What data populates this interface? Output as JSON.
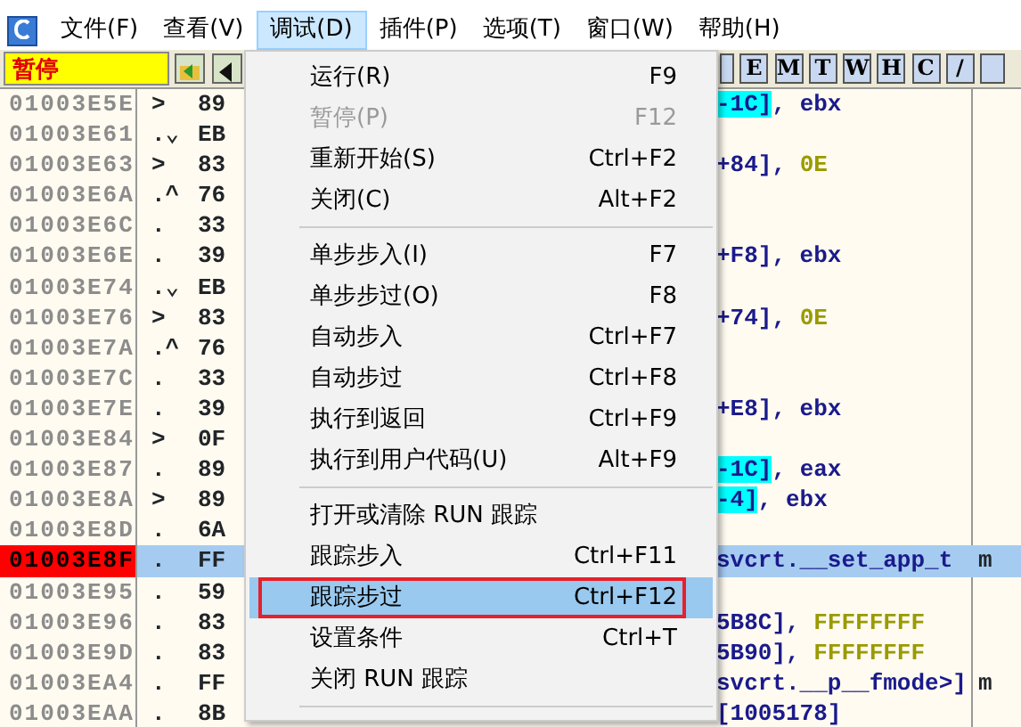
{
  "menubar": {
    "items": [
      {
        "label": "文件(F)",
        "selected": false
      },
      {
        "label": "查看(V)",
        "selected": false
      },
      {
        "label": "调试(D)",
        "selected": true
      },
      {
        "label": "插件(P)",
        "selected": false
      },
      {
        "label": "选项(T)",
        "selected": false
      },
      {
        "label": "窗口(W)",
        "selected": false
      },
      {
        "label": "帮助(H)",
        "selected": false
      }
    ]
  },
  "toolbar": {
    "status": "暂停",
    "letter_buttons": [
      "E",
      "M",
      "T",
      "W",
      "H",
      "C",
      "/"
    ]
  },
  "listing": {
    "rows": [
      {
        "address": "01003E5E",
        "mark": ">",
        "hex": "89",
        "disasm": [
          {
            "text": "-1C]",
            "kind": "operand"
          },
          {
            "text": ", ebx",
            "kind": "plain"
          }
        ],
        "current": false,
        "selected": false
      },
      {
        "address": "01003E61",
        "mark": ".⌄",
        "hex": "EB",
        "disasm": [],
        "current": false,
        "selected": false
      },
      {
        "address": "01003E63",
        "mark": ">",
        "hex": "83",
        "disasm": [
          {
            "text": "+84], ",
            "kind": "plain"
          },
          {
            "text": "0E",
            "kind": "const"
          }
        ],
        "current": false,
        "selected": false
      },
      {
        "address": "01003E6A",
        "mark": ".^",
        "hex": "76",
        "disasm": [],
        "current": false,
        "selected": false
      },
      {
        "address": "01003E6C",
        "mark": ".",
        "hex": "33",
        "disasm": [],
        "current": false,
        "selected": false
      },
      {
        "address": "01003E6E",
        "mark": ".",
        "hex": "39",
        "disasm": [
          {
            "text": "+F8], ebx",
            "kind": "plain"
          }
        ],
        "current": false,
        "selected": false
      },
      {
        "address": "01003E74",
        "mark": ".⌄",
        "hex": "EB",
        "disasm": [],
        "current": false,
        "selected": false
      },
      {
        "address": "01003E76",
        "mark": ">",
        "hex": "83",
        "disasm": [
          {
            "text": "+74], ",
            "kind": "plain"
          },
          {
            "text": "0E",
            "kind": "const"
          }
        ],
        "current": false,
        "selected": false
      },
      {
        "address": "01003E7A",
        "mark": ".^",
        "hex": "76",
        "disasm": [],
        "current": false,
        "selected": false
      },
      {
        "address": "01003E7C",
        "mark": ".",
        "hex": "33",
        "disasm": [],
        "current": false,
        "selected": false
      },
      {
        "address": "01003E7E",
        "mark": ".",
        "hex": "39",
        "disasm": [
          {
            "text": "+E8], ebx",
            "kind": "plain"
          }
        ],
        "current": false,
        "selected": false
      },
      {
        "address": "01003E84",
        "mark": ">",
        "hex": "0F",
        "disasm": [],
        "current": false,
        "selected": false
      },
      {
        "address": "01003E87",
        "mark": ".",
        "hex": "89",
        "disasm": [
          {
            "text": "-1C]",
            "kind": "operand"
          },
          {
            "text": ", eax",
            "kind": "plain"
          }
        ],
        "current": false,
        "selected": false
      },
      {
        "address": "01003E8A",
        "mark": ">",
        "hex": "89",
        "disasm": [
          {
            "text": "-4]",
            "kind": "operand"
          },
          {
            "text": ", ebx",
            "kind": "plain"
          }
        ],
        "current": false,
        "selected": false
      },
      {
        "address": "01003E8D",
        "mark": ".",
        "hex": "6A",
        "disasm": [],
        "current": false,
        "selected": false
      },
      {
        "address": "01003E8F",
        "mark": ".",
        "hex": "FF",
        "disasm": [
          {
            "text": "svcrt.__set_app_t",
            "kind": "plain"
          }
        ],
        "comment": "m",
        "current": true,
        "selected": true
      },
      {
        "address": "01003E95",
        "mark": ".",
        "hex": "59",
        "disasm": [],
        "current": false,
        "selected": false
      },
      {
        "address": "01003E96",
        "mark": ".",
        "hex": "83",
        "disasm": [
          {
            "text": "5B8C], ",
            "kind": "plain"
          },
          {
            "text": "FFFFFFFF",
            "kind": "const"
          }
        ],
        "current": false,
        "selected": false
      },
      {
        "address": "01003E9D",
        "mark": ".",
        "hex": "83",
        "disasm": [
          {
            "text": "5B90], ",
            "kind": "plain"
          },
          {
            "text": "FFFFFFFF",
            "kind": "const"
          }
        ],
        "current": false,
        "selected": false
      },
      {
        "address": "01003EA4",
        "mark": ".",
        "hex": "FF",
        "disasm": [
          {
            "text": "svcrt.__p__fmode>]",
            "kind": "plain"
          }
        ],
        "comment": "m",
        "current": false,
        "selected": false
      },
      {
        "address": "01003EAA",
        "mark": ".",
        "hex": "8B",
        "disasm": [
          {
            "text": " [1005178]",
            "kind": "plain"
          }
        ],
        "current": false,
        "selected": false
      }
    ]
  },
  "dropdown_menu": {
    "items": [
      {
        "kind": "item",
        "label": "运行(R)",
        "shortcut": "F9",
        "disabled": false,
        "selected": false
      },
      {
        "kind": "item",
        "label": "暂停(P)",
        "shortcut": "F12",
        "disabled": true,
        "selected": false
      },
      {
        "kind": "item",
        "label": "重新开始(S)",
        "shortcut": "Ctrl+F2",
        "disabled": false,
        "selected": false
      },
      {
        "kind": "item",
        "label": "关闭(C)",
        "shortcut": "Alt+F2",
        "disabled": false,
        "selected": false
      },
      {
        "kind": "separator"
      },
      {
        "kind": "item",
        "label": "单步步入(I)",
        "shortcut": "F7",
        "disabled": false,
        "selected": false
      },
      {
        "kind": "item",
        "label": "单步步过(O)",
        "shortcut": "F8",
        "disabled": false,
        "selected": false
      },
      {
        "kind": "item",
        "label": "自动步入",
        "shortcut": "Ctrl+F7",
        "disabled": false,
        "selected": false
      },
      {
        "kind": "item",
        "label": "自动步过",
        "shortcut": "Ctrl+F8",
        "disabled": false,
        "selected": false
      },
      {
        "kind": "item",
        "label": "执行到返回",
        "shortcut": "Ctrl+F9",
        "disabled": false,
        "selected": false
      },
      {
        "kind": "item",
        "label": "执行到用户代码(U)",
        "shortcut": "Alt+F9",
        "disabled": false,
        "selected": false
      },
      {
        "kind": "separator"
      },
      {
        "kind": "item",
        "label": "打开或清除 RUN 跟踪",
        "disabled": false,
        "selected": false
      },
      {
        "kind": "item",
        "label": "跟踪步入",
        "shortcut": "Ctrl+F11",
        "disabled": false,
        "selected": false
      },
      {
        "kind": "item",
        "label": "跟踪步过",
        "shortcut": "Ctrl+F12",
        "disabled": false,
        "selected": true,
        "outlined": true
      },
      {
        "kind": "item",
        "label": "设置条件",
        "shortcut": "Ctrl+T",
        "disabled": false,
        "selected": false
      },
      {
        "kind": "item",
        "label": "关闭 RUN 跟踪",
        "disabled": false,
        "selected": false
      },
      {
        "kind": "separator"
      }
    ]
  }
}
